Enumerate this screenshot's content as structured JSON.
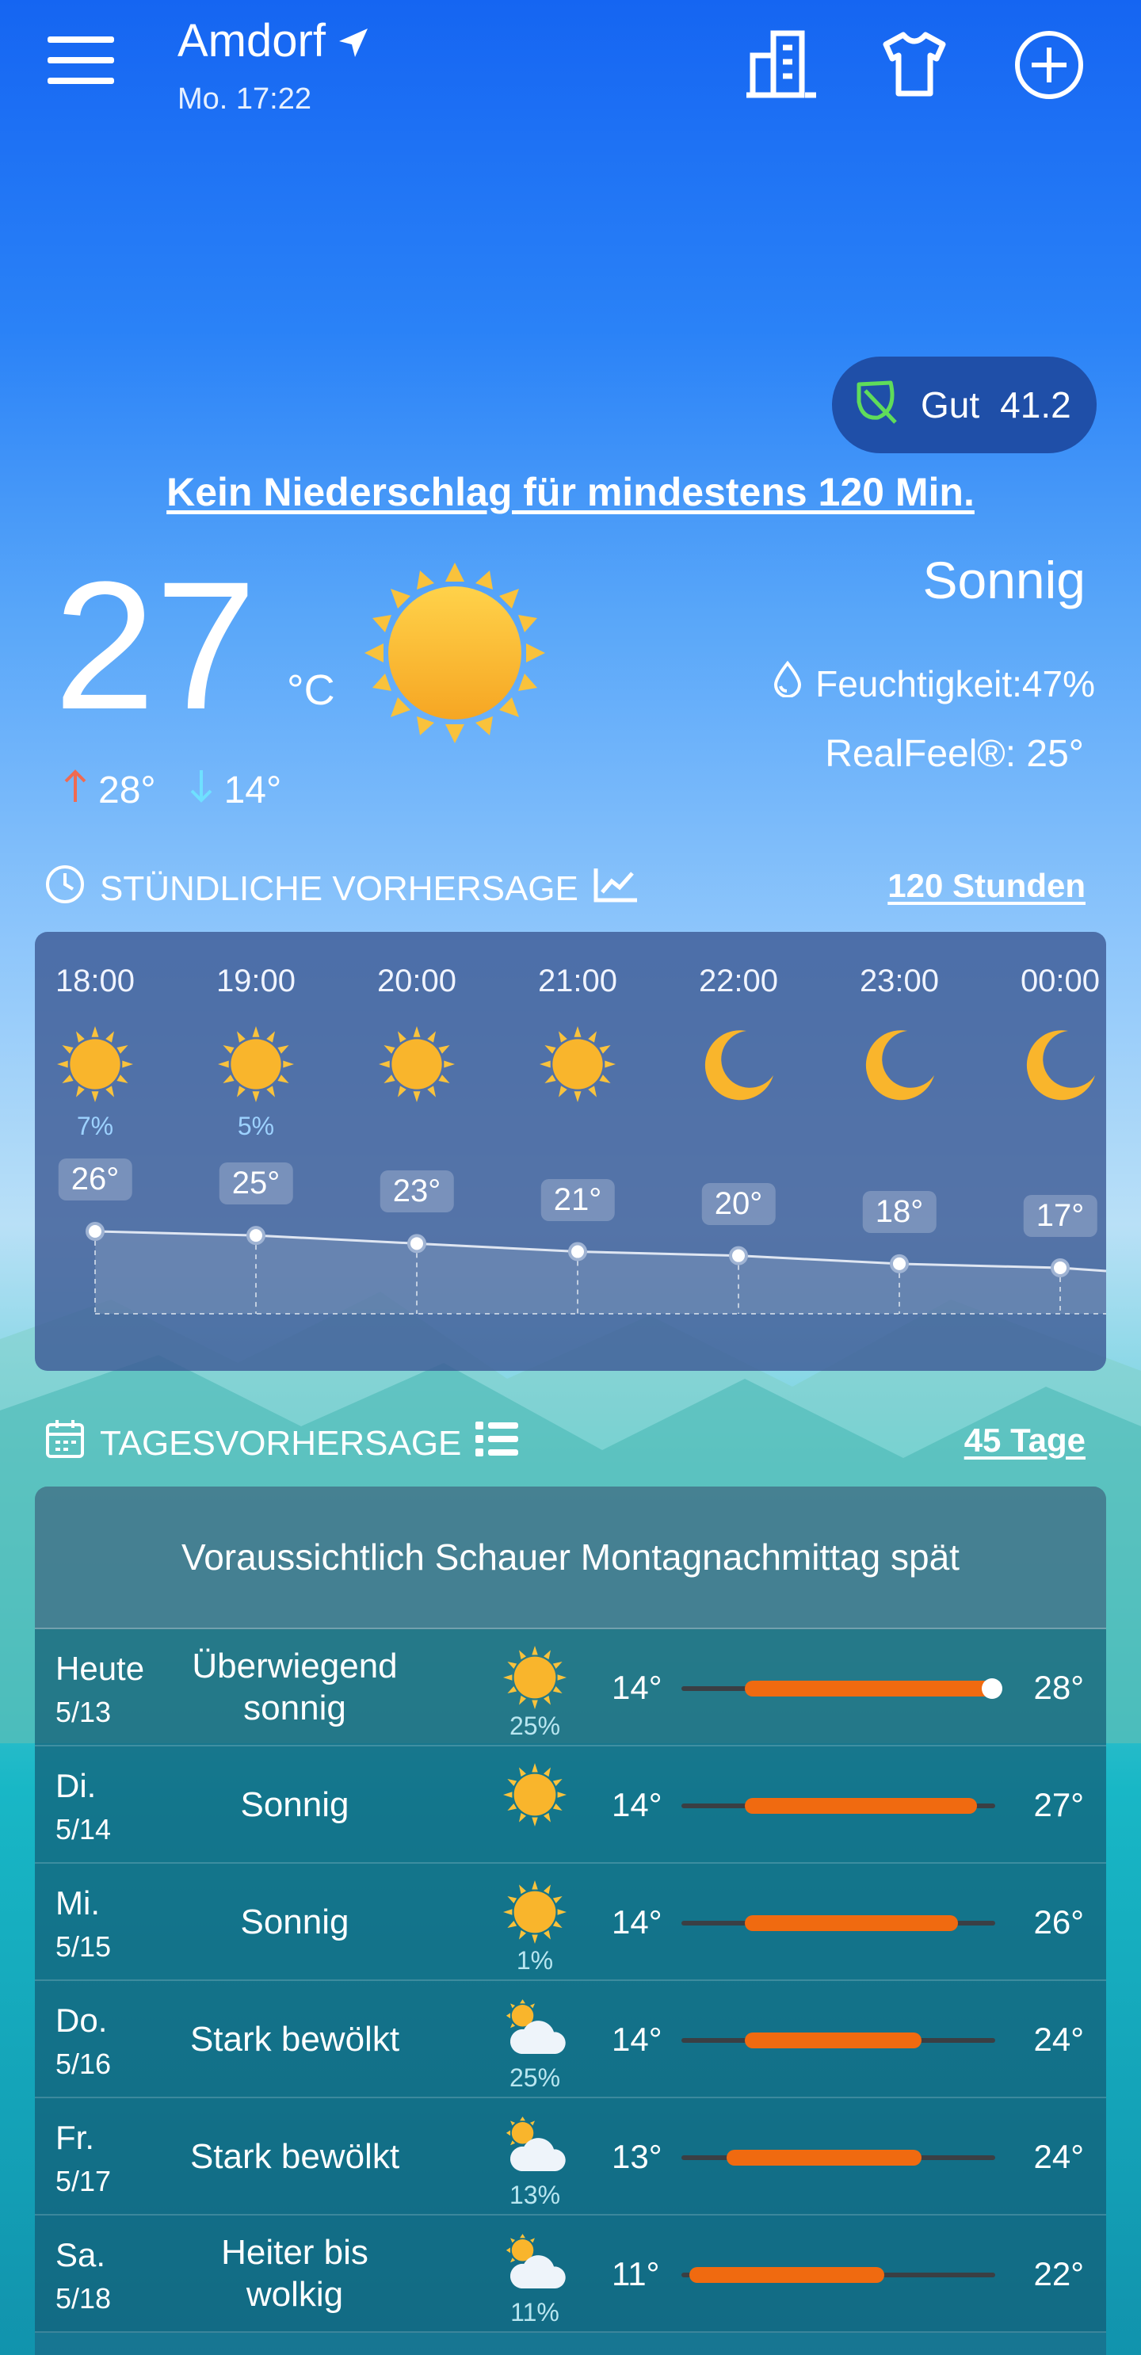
{
  "header": {
    "city": "Amdorf",
    "time": "Mo. 17:22",
    "icons": [
      "menu-icon",
      "location-arrow-icon",
      "building-icon",
      "shirt-icon",
      "add-icon"
    ]
  },
  "aqi": {
    "label": "Gut",
    "value": "41.2",
    "icon": "leaf-icon"
  },
  "precip_notice": "Kein Niederschlag für mindestens 120 Min.",
  "current": {
    "temp": "27",
    "unit": "°C",
    "condition": "Sonnig",
    "humidity": "Feuchtigkeit:47%",
    "realfeel": "RealFeel®: 25°",
    "high": "28°",
    "low": "14°"
  },
  "hourly_section": {
    "title": "STÜNDLICHE VORHERSAGE",
    "link": "120 Stunden"
  },
  "hourly": [
    {
      "time": "18:00",
      "icon": "sun",
      "precip": "7%",
      "temp": "26°",
      "value": 26
    },
    {
      "time": "19:00",
      "icon": "sun",
      "precip": "5%",
      "temp": "25°",
      "value": 25
    },
    {
      "time": "20:00",
      "icon": "sun",
      "precip": "",
      "temp": "23°",
      "value": 23
    },
    {
      "time": "21:00",
      "icon": "sun",
      "precip": "",
      "temp": "21°",
      "value": 21
    },
    {
      "time": "22:00",
      "icon": "moon",
      "precip": "",
      "temp": "20°",
      "value": 20
    },
    {
      "time": "23:00",
      "icon": "moon",
      "precip": "",
      "temp": "18°",
      "value": 18
    },
    {
      "time": "00:00",
      "icon": "moon",
      "precip": "",
      "temp": "17°",
      "value": 17
    }
  ],
  "daily_section": {
    "title": "TAGESVORHERSAGE",
    "link": "45 Tage"
  },
  "daily_summary": "Voraussichtlich Schauer Montagnachmittag spät",
  "daily": [
    {
      "day": "Heute",
      "date": "5/13",
      "condition": "Überwiegend sonnig",
      "icon": "sun",
      "precip": "25%",
      "low": "14°",
      "high": "28°",
      "lo_val": 14,
      "hi_val": 28,
      "current_dot": true
    },
    {
      "day": "Di.",
      "date": "5/14",
      "condition": "Sonnig",
      "icon": "sun",
      "precip": "",
      "low": "14°",
      "high": "27°",
      "lo_val": 14,
      "hi_val": 27
    },
    {
      "day": "Mi.",
      "date": "5/15",
      "condition": "Sonnig",
      "icon": "sun",
      "precip": "1%",
      "low": "14°",
      "high": "26°",
      "lo_val": 14,
      "hi_val": 26
    },
    {
      "day": "Do.",
      "date": "5/16",
      "condition": "Stark bewölkt",
      "icon": "sun-cloud",
      "precip": "25%",
      "low": "14°",
      "high": "24°",
      "lo_val": 14,
      "hi_val": 24
    },
    {
      "day": "Fr.",
      "date": "5/17",
      "condition": "Stark bewölkt",
      "icon": "sun-cloud",
      "precip": "13%",
      "low": "13°",
      "high": "24°",
      "lo_val": 13,
      "hi_val": 24
    },
    {
      "day": "Sa.",
      "date": "5/18",
      "condition": "Heiter bis wolkig",
      "icon": "sun-cloud",
      "precip": "11%",
      "low": "11°",
      "high": "22°",
      "lo_val": 11,
      "hi_val": 22
    }
  ],
  "colors": {
    "bar": "#f06a10",
    "sun": "#f9b52c",
    "aqi_bg": "#1f4fa8",
    "leaf": "#5fdc5a"
  }
}
